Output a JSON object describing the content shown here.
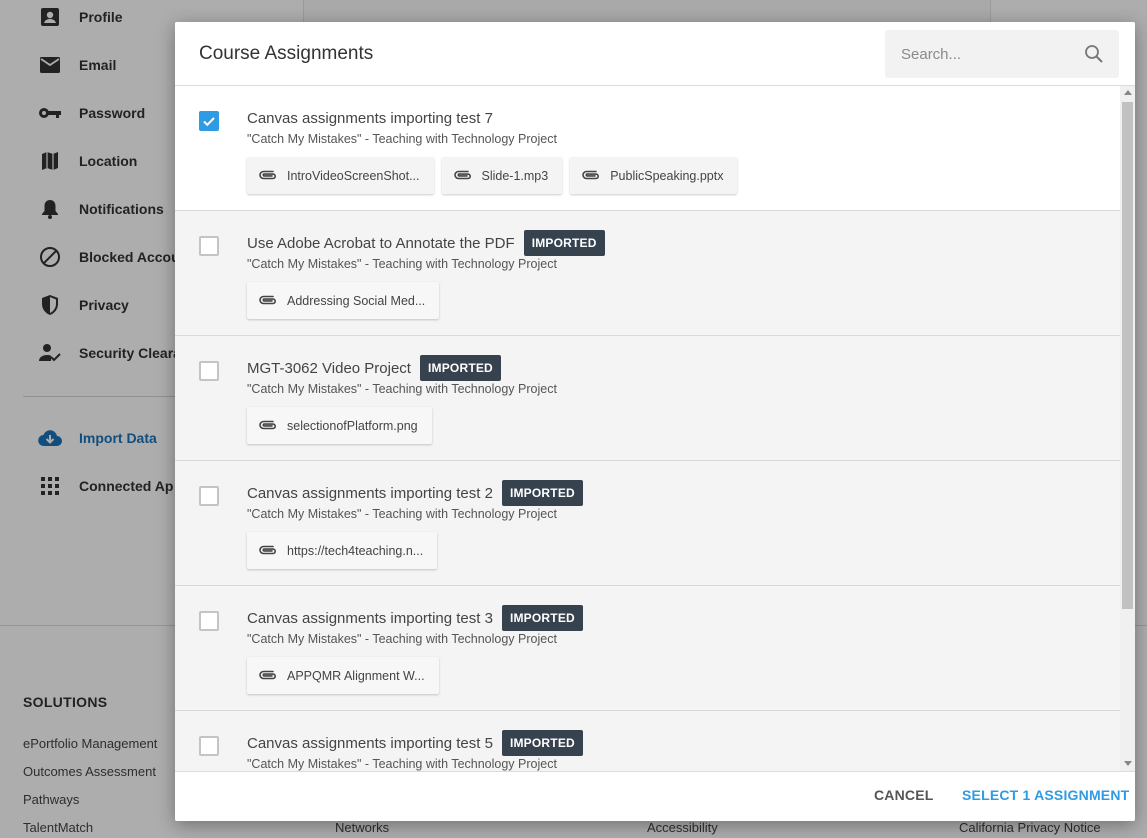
{
  "sidebar": {
    "items": [
      {
        "label": "Profile",
        "icon": "profile-icon"
      },
      {
        "label": "Email",
        "icon": "email-icon"
      },
      {
        "label": "Password",
        "icon": "key-icon"
      },
      {
        "label": "Location",
        "icon": "map-icon"
      },
      {
        "label": "Notifications",
        "icon": "bell-icon"
      },
      {
        "label": "Blocked Accou",
        "icon": "blocked-icon"
      },
      {
        "label": "Privacy",
        "icon": "shield-icon"
      },
      {
        "label": "Security Cleara",
        "icon": "security-user-icon"
      }
    ],
    "lower_items": [
      {
        "label": "Import Data",
        "icon": "cloud-download-icon"
      },
      {
        "label": "Connected Ap",
        "icon": "apps-grid-icon"
      }
    ]
  },
  "footer": {
    "heading": "SOLUTIONS",
    "links": [
      "ePortfolio Management",
      "Outcomes Assessment",
      "Pathways",
      "TalentMatch"
    ],
    "bottom_links": [
      "Networks",
      "Accessibility",
      "California Privacy Notice"
    ]
  },
  "modal": {
    "title": "Course Assignments",
    "search_placeholder": "Search...",
    "assignments": [
      {
        "title": "Canvas assignments importing test 7",
        "course": "\"Catch My Mistakes\" - Teaching with Technology Project",
        "checked": true,
        "badge": "",
        "attachments": [
          "IntroVideoScreenShot...",
          "Slide-1.mp3",
          "PublicSpeaking.pptx"
        ]
      },
      {
        "title": "Use Adobe Acrobat to Annotate the PDF",
        "course": "\"Catch My Mistakes\" - Teaching with Technology Project",
        "checked": false,
        "badge": "IMPORTED",
        "attachments": [
          "Addressing Social Med..."
        ]
      },
      {
        "title": "MGT-3062 Video Project",
        "course": "\"Catch My Mistakes\" - Teaching with Technology Project",
        "checked": false,
        "badge": "IMPORTED",
        "attachments": [
          "selectionofPlatform.png"
        ]
      },
      {
        "title": "Canvas assignments importing test 2",
        "course": "\"Catch My Mistakes\" - Teaching with Technology Project",
        "checked": false,
        "badge": "IMPORTED",
        "attachments": [
          "https://tech4teaching.n..."
        ]
      },
      {
        "title": "Canvas assignments importing test 3",
        "course": "\"Catch My Mistakes\" - Teaching with Technology Project",
        "checked": false,
        "badge": "IMPORTED",
        "attachments": [
          "APPQMR Alignment W..."
        ]
      },
      {
        "title": "Canvas assignments importing test 5",
        "course": "\"Catch My Mistakes\" - Teaching with Technology Project",
        "checked": false,
        "badge": "IMPORTED",
        "attachments": []
      }
    ],
    "cancel_label": "CANCEL",
    "select_label": "SELECT 1 ASSIGNMENT"
  },
  "colors": {
    "accent": "#2e9be3",
    "badge_bg": "#37424f",
    "active_nav": "#1a73b8"
  }
}
